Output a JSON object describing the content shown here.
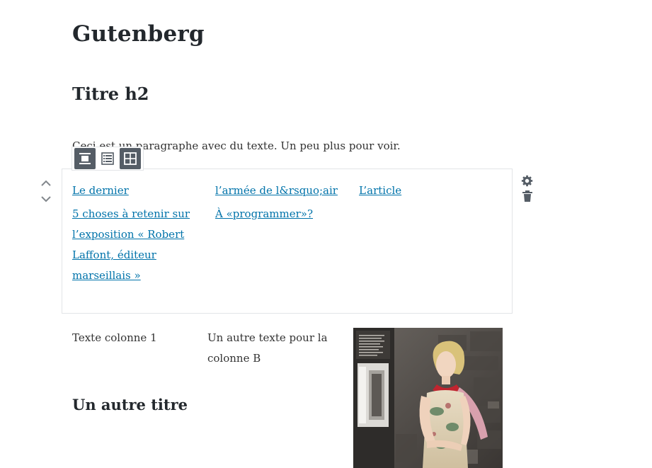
{
  "post": {
    "title": "Gutenberg"
  },
  "blocks": {
    "heading_h2": "Titre h2",
    "paragraph": "Ceci est un paragraphe avec du texte. Un peu plus pour voir."
  },
  "toolbar": {
    "buttons": [
      {
        "icon": "align-center-icon",
        "active": true
      },
      {
        "icon": "list-view-icon",
        "active": false
      },
      {
        "icon": "grid-view-icon",
        "active": true
      }
    ]
  },
  "mover": {
    "up_icon": "chevron-up-icon",
    "down_icon": "chevron-down-icon"
  },
  "latest_posts": [
    "Le dernier",
    "l’armée de l&rsquo;air",
    "L’article",
    "5 choses à retenir sur l’exposition « Robert Laffont, éditeur marseillais »",
    "À «programmer»?"
  ],
  "block_actions": {
    "settings_icon": "gear-icon",
    "delete_icon": "trash-icon"
  },
  "columns": {
    "col1_text": "Texte colonne 1",
    "col2_text": "Un autre texte pour la colonne B",
    "heading": "Un autre titre",
    "image_alt": "fashion-photo"
  },
  "colors": {
    "link": "#0073aa",
    "toolbar_active": "#555d66",
    "border": "#e2e4e7"
  }
}
